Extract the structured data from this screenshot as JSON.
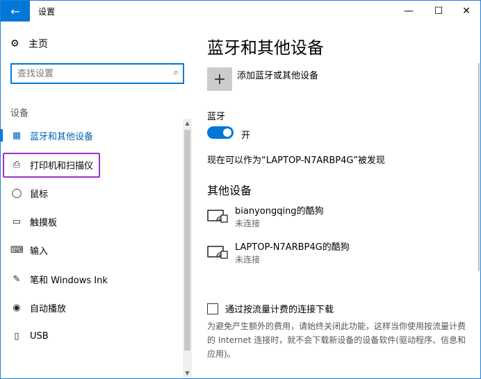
{
  "window": {
    "title": "设置",
    "back_icon": "←",
    "minimize_icon": "—",
    "maximize_icon": "☐",
    "close_icon": "✕"
  },
  "sidebar": {
    "home_label": "主页",
    "search_placeholder": "查找设置",
    "section_label": "设备",
    "items": [
      {
        "label": "蓝牙和其他设备",
        "icon": "bluetooth-devices-icon",
        "glyph": "▦",
        "active": true
      },
      {
        "label": "打印机和扫描仪",
        "icon": "printer-icon",
        "glyph": "⎙",
        "active": false
      },
      {
        "label": "鼠标",
        "icon": "mouse-icon",
        "glyph": "◯",
        "active": false
      },
      {
        "label": "触摸板",
        "icon": "touchpad-icon",
        "glyph": "▭",
        "active": false
      },
      {
        "label": "输入",
        "icon": "keyboard-icon",
        "glyph": "⌨",
        "active": false
      },
      {
        "label": "笔和 Windows Ink",
        "icon": "pen-icon",
        "glyph": "✎",
        "active": false
      },
      {
        "label": "自动播放",
        "icon": "autoplay-icon",
        "glyph": "◉",
        "active": false
      },
      {
        "label": "USB",
        "icon": "usb-icon",
        "glyph": "▯",
        "active": false
      }
    ]
  },
  "main": {
    "title": "蓝牙和其他设备",
    "add_label": "添加蓝牙或其他设备",
    "add_glyph": "+",
    "bluetooth_label": "蓝牙",
    "toggle_label": "开",
    "toggle_on": true,
    "discoverable_text": "现在可以作为“LAPTOP-N7ARBP4G”被发现",
    "other_devices_title": "其他设备",
    "devices": [
      {
        "name": "bianyongqing的酷狗",
        "status": "未连接",
        "glyph": "▭"
      },
      {
        "name": "LAPTOP-N7ARBP4G的酷狗",
        "status": "未连接",
        "glyph": "▭"
      }
    ],
    "metered_label": "通过按流量计费的连接下载",
    "metered_desc": "为避免产生额外的费用，请始终关闭此功能，这样当你使用按流量计费的 Internet 连接时，就不会下载新设备的设备软件(驱动程序、信息和应用)。"
  },
  "colors": {
    "accent": "#0078d7",
    "highlight_box": "#9b30c8"
  }
}
